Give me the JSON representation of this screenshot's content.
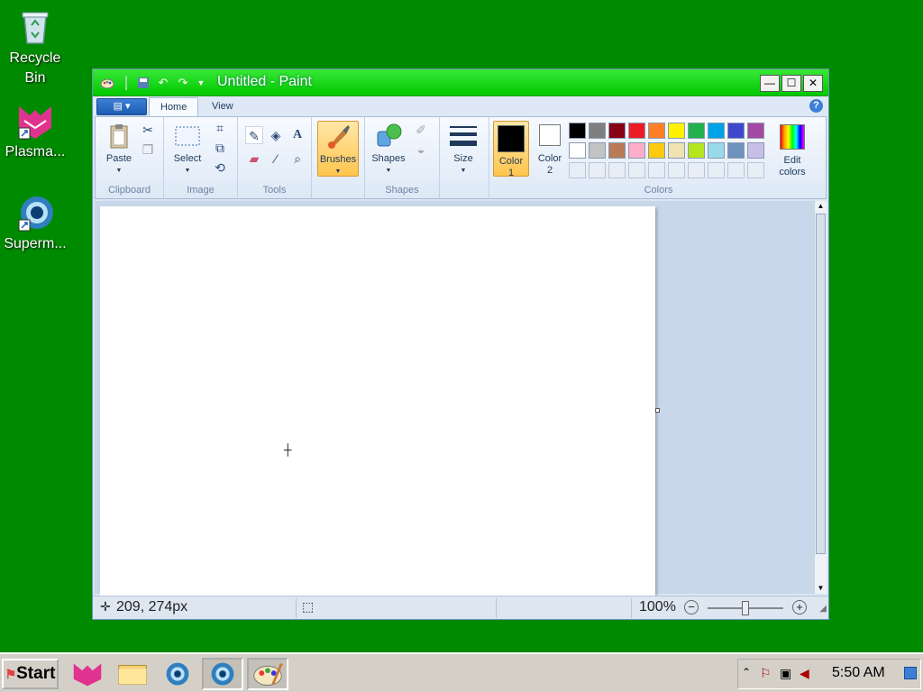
{
  "desktop": {
    "icons": [
      {
        "label_line1": "Recycle",
        "label_line2": "Bin",
        "icon": "recycle-bin-icon"
      },
      {
        "label_line1": "Plasma...",
        "label_line2": "",
        "icon": "plasma-shortcut-icon"
      },
      {
        "label_line1": "Superm...",
        "label_line2": "",
        "icon": "superm-shortcut-icon"
      }
    ]
  },
  "window": {
    "title": "Untitled - Paint",
    "controls": {
      "minimize": "—",
      "maximize": "☐",
      "close": "✕"
    },
    "tabs": [
      {
        "label": "Home",
        "active": true
      },
      {
        "label": "View",
        "active": false
      }
    ],
    "help": "?"
  },
  "ribbon": {
    "groups": {
      "clipboard": "Clipboard",
      "image": "Image",
      "tools": "Tools",
      "shapes": "Shapes",
      "colors": "Colors"
    },
    "buttons": {
      "paste": "Paste",
      "select": "Select",
      "brushes": "Brushes",
      "shapes": "Shapes",
      "size": "Size",
      "color1_line1": "Color",
      "color1_line2": "1",
      "color2_line1": "Color",
      "color2_line2": "2",
      "edit_colors_line1": "Edit",
      "edit_colors_line2": "colors"
    },
    "palette_row1": [
      "#000000",
      "#7f7f7f",
      "#880015",
      "#ed1c24",
      "#ff7f27",
      "#fff200",
      "#22b14c",
      "#00a2e8",
      "#3f48cc",
      "#a349a4"
    ],
    "palette_row2": [
      "#ffffff",
      "#c3c3c3",
      "#b97a57",
      "#ffaec9",
      "#ffc90e",
      "#efe4b0",
      "#b5e61d",
      "#99d9ea",
      "#7092be",
      "#c8bfe7"
    ],
    "color1": "#000000",
    "color2": "#ffffff"
  },
  "statusbar": {
    "position": "209, 274px",
    "zoom": "100%"
  },
  "taskbar": {
    "start": "Start",
    "clock": "5:50 AM"
  }
}
